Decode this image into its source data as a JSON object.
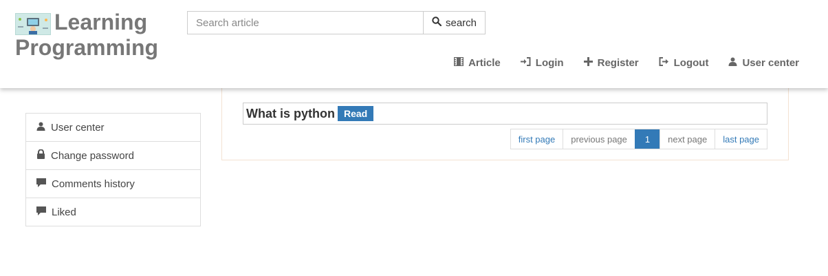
{
  "header": {
    "logo": {
      "line1": "Learning",
      "line2": "Programming"
    },
    "search": {
      "placeholder": "Search article",
      "button_label": "search"
    },
    "nav": [
      {
        "label": "Article",
        "icon": "film-icon"
      },
      {
        "label": "Login",
        "icon": "login-icon"
      },
      {
        "label": "Register",
        "icon": "plus-icon"
      },
      {
        "label": "Logout",
        "icon": "logout-icon"
      },
      {
        "label": "User center",
        "icon": "user-icon"
      }
    ]
  },
  "sidebar": {
    "items": [
      {
        "label": "User center",
        "icon": "user-icon"
      },
      {
        "label": "Change password",
        "icon": "lock-icon"
      },
      {
        "label": "Comments history",
        "icon": "comment-icon"
      },
      {
        "label": "Liked",
        "icon": "comment-icon"
      }
    ]
  },
  "main": {
    "article": {
      "title": "What is python",
      "badge": "Read"
    },
    "pagination": {
      "first": "first page",
      "previous": "previous page",
      "current": "1",
      "next": "next page",
      "last": "last page"
    }
  },
  "colors": {
    "primary": "#337ab7",
    "logo_text": "#777777",
    "panel_border": "#f3e2d2"
  }
}
